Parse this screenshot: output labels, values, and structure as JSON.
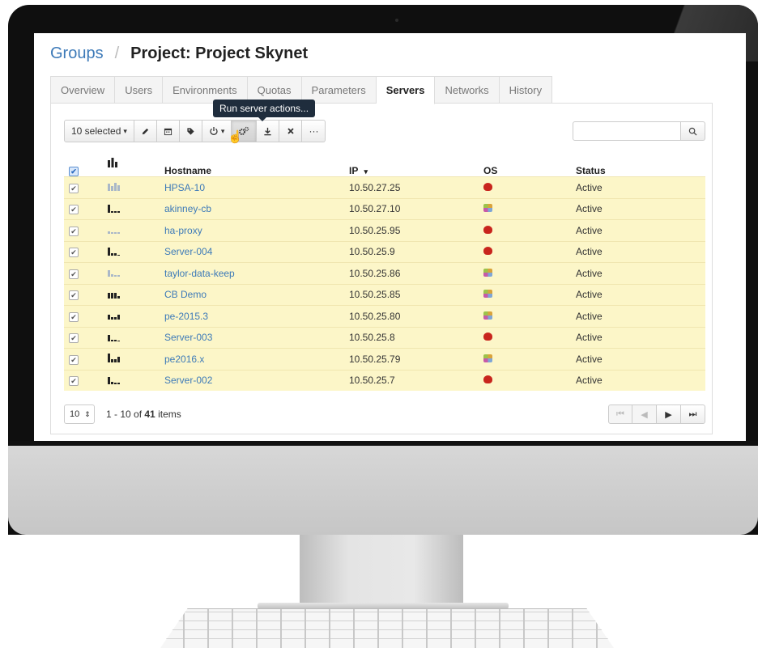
{
  "breadcrumb": {
    "parent": "Groups",
    "separator": "/",
    "current": "Project: Project Skynet"
  },
  "tabs": [
    {
      "label": "Overview",
      "active": false
    },
    {
      "label": "Users",
      "active": false
    },
    {
      "label": "Environments",
      "active": false
    },
    {
      "label": "Quotas",
      "active": false
    },
    {
      "label": "Parameters",
      "active": false
    },
    {
      "label": "Servers",
      "active": true
    },
    {
      "label": "Networks",
      "active": false
    },
    {
      "label": "History",
      "active": false
    }
  ],
  "toolbar": {
    "selected_label": "10 selected",
    "tooltip": "Run server actions...",
    "icons": [
      "pencil-icon",
      "calendar-icon",
      "tag-icon",
      "power-icon",
      "gears-icon",
      "download-icon",
      "close-icon",
      "ellipsis-icon"
    ],
    "more_label": "···"
  },
  "search": {
    "value": "",
    "placeholder": ""
  },
  "table": {
    "columns": {
      "hostname": "Hostname",
      "ip": "IP",
      "ip_sort": "▾",
      "os": "OS",
      "status": "Status"
    },
    "rows": [
      {
        "hostname": "HPSA-10",
        "ip": "10.50.27.25",
        "os": "redhat",
        "status": "Active",
        "spark": [
          0.8,
          0.5,
          0.9,
          0.6
        ]
      },
      {
        "hostname": "akinney-cb",
        "ip": "10.50.27.10",
        "os": "linux",
        "status": "Active",
        "spark": [
          0.9,
          0.2,
          0.2,
          0.2
        ]
      },
      {
        "hostname": "ha-proxy",
        "ip": "10.50.25.95",
        "os": "redhat",
        "status": "Active",
        "spark": [
          0.3,
          0.15,
          0.15,
          0.15
        ]
      },
      {
        "hostname": "Server-004",
        "ip": "10.50.25.9",
        "os": "redhat",
        "status": "Active",
        "spark": [
          0.9,
          0.25,
          0.25,
          0
        ]
      },
      {
        "hostname": "taylor-data-keep",
        "ip": "10.50.25.86",
        "os": "linux",
        "status": "Active",
        "spark": [
          0.7,
          0.3,
          0.2,
          0.2
        ]
      },
      {
        "hostname": "CB Demo",
        "ip": "10.50.25.85",
        "os": "linux",
        "status": "Active",
        "spark": [
          0.6,
          0.6,
          0.6,
          0.3
        ]
      },
      {
        "hostname": "pe-2015.3",
        "ip": "10.50.25.80",
        "os": "linux",
        "status": "Active",
        "spark": [
          0.5,
          0.3,
          0.3,
          0.5
        ]
      },
      {
        "hostname": "Server-003",
        "ip": "10.50.25.8",
        "os": "redhat",
        "status": "Active",
        "spark": [
          0.7,
          0.2,
          0.2,
          0
        ]
      },
      {
        "hostname": "pe2016.x",
        "ip": "10.50.25.79",
        "os": "linux",
        "status": "Active",
        "spark": [
          1,
          0.4,
          0.4,
          0.6
        ]
      },
      {
        "hostname": "Server-002",
        "ip": "10.50.25.7",
        "os": "redhat",
        "status": "Active",
        "spark": [
          0.8,
          0.3,
          0.2,
          0.2
        ]
      }
    ]
  },
  "footer": {
    "page_size": "10",
    "range_prefix": "1 - 10 of",
    "total": "41",
    "range_suffix": "items"
  },
  "colors": {
    "link": "#3d7ab8",
    "selected_row": "#fcf6c8",
    "tooltip_bg": "#1f2d3d",
    "redhat": "#c8251d"
  }
}
